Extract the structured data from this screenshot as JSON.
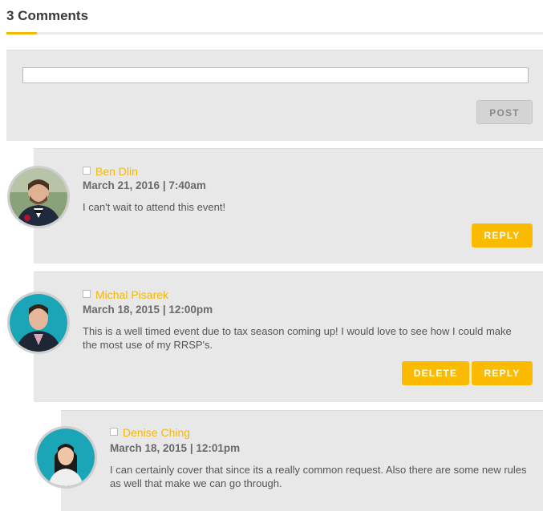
{
  "heading": "3 Comments",
  "composer": {
    "input_value": "",
    "post_label": "POST"
  },
  "comments": [
    {
      "author": "Ben Dlin",
      "date": "March 21, 2016 | 7:40am",
      "text": "I can't wait to attend this event!",
      "reply_label": "REPLY"
    },
    {
      "author": "Michal Pisarek",
      "date": "March 18, 2015 | 12:00pm",
      "text": "This is a well timed event due to tax season coming up! I would love to see how I could make the most use of my RRSP's.",
      "delete_label": "DELETE",
      "reply_label": "REPLY"
    },
    {
      "author": "Denise Ching",
      "date": "March 18, 2015 | 12:01pm",
      "text": "I can certainly cover that since its a really common request. Also there are some new rules as well that make we can go through."
    }
  ],
  "colors": {
    "accent": "#f5b800",
    "button": "#fbbb00",
    "panel": "#e8e8e8",
    "avatar_bg_teal": "#1aa6b7"
  },
  "icons": {
    "avatar_1": "user-avatar-photo",
    "avatar_2": "user-avatar-photo",
    "avatar_3": "user-avatar-photo",
    "checkbox": "checkbox-icon"
  }
}
